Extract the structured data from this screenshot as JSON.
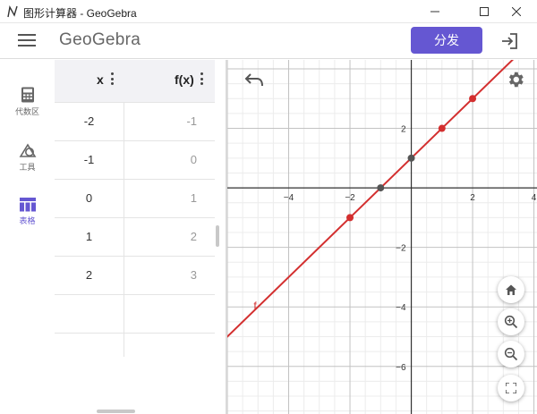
{
  "window": {
    "title": "图形计算器 - GeoGebra",
    "controls": [
      "minimize-icon",
      "maximize-icon",
      "close-icon"
    ]
  },
  "header": {
    "brand": "GeoGebra",
    "share_label": "分发",
    "icons": [
      "menu-icon",
      "sign-in-icon"
    ]
  },
  "nav": {
    "items": [
      {
        "label": "代数区",
        "icon": "calculator-icon",
        "active": false
      },
      {
        "label": "工具",
        "icon": "shapes-icon",
        "active": false
      },
      {
        "label": "表格",
        "icon": "table-icon",
        "active": true
      }
    ]
  },
  "table": {
    "headers": [
      "x",
      "f(x)"
    ],
    "rows": [
      {
        "x": "-2",
        "fx": "-1"
      },
      {
        "x": "-1",
        "fx": "0"
      },
      {
        "x": "0",
        "fx": "1"
      },
      {
        "x": "1",
        "fx": "2"
      },
      {
        "x": "2",
        "fx": "3"
      },
      {
        "x": "",
        "fx": ""
      },
      {
        "x": "",
        "fx": ""
      }
    ]
  },
  "graphics": {
    "function_label": "f",
    "icons": [
      "undo-icon",
      "settings-icon",
      "home-icon",
      "zoom-in-icon",
      "zoom-out-icon",
      "fullscreen-icon"
    ]
  },
  "chart_data": {
    "type": "line",
    "function": "f(x) = x + 1",
    "x_ticks": [
      "−4",
      "−2",
      "2",
      "4"
    ],
    "y_ticks": [
      "2",
      "−2",
      "−4",
      "−6"
    ],
    "xlim": [
      -6,
      4.1
    ],
    "ylim": [
      -7.6,
      4.3
    ],
    "grid": true,
    "series": [
      {
        "name": "f",
        "color": "#d32f2f",
        "slope": 1,
        "intercept": 1
      }
    ],
    "points": [
      {
        "x": -2,
        "y": -1,
        "color": "#d32f2f"
      },
      {
        "x": 1,
        "y": 2,
        "color": "#d32f2f"
      },
      {
        "x": 2,
        "y": 3,
        "color": "#d32f2f"
      },
      {
        "x": -1,
        "y": 0,
        "color": "#555555"
      },
      {
        "x": 0,
        "y": 1,
        "color": "#555555"
      }
    ]
  },
  "colors": {
    "accent": "#6557d2",
    "function": "#d32f2f",
    "special_point": "#555555"
  }
}
